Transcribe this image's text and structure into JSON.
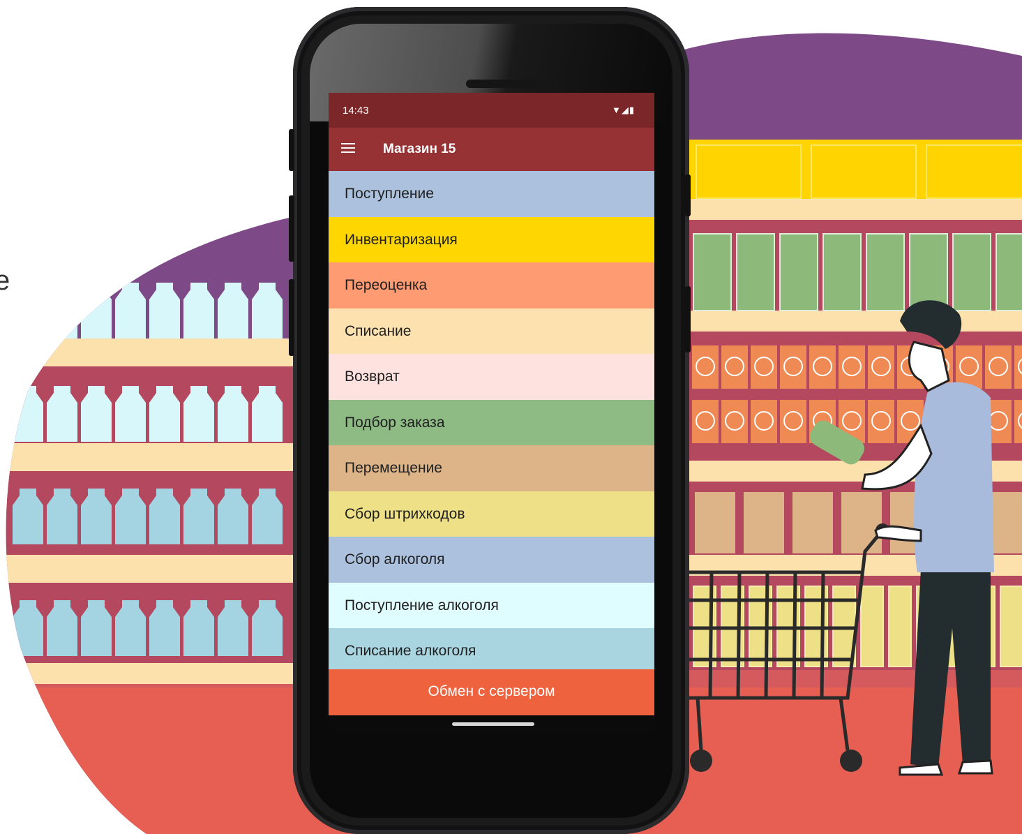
{
  "background": {
    "letter": "e",
    "colors": {
      "purple": "#7d4a87",
      "cream": "#fde1ad",
      "maroon": "#b3485f",
      "floor": "#e65f52",
      "yellow_box": "#ffd400",
      "green_box": "#8dba7a",
      "orange_can": "#f08a54",
      "bottle_light": "#d8f7fa",
      "bottle_blue": "#a4d3e1"
    }
  },
  "status": {
    "time": "14:43",
    "icons": "▼◢▮"
  },
  "app": {
    "store_name": "Магазин 15",
    "menu_icon": "hamburger-menu-icon"
  },
  "menu": [
    {
      "label": "Поступление",
      "color": "#abc1dd"
    },
    {
      "label": "Инвентаризация",
      "color": "#fed602"
    },
    {
      "label": "Переоценка",
      "color": "#fe9b73"
    },
    {
      "label": "Списание",
      "color": "#fde2b0"
    },
    {
      "label": "Возврат",
      "color": "#fde2e0"
    },
    {
      "label": "Подбор заказа",
      "color": "#8ebb84"
    },
    {
      "label": "Перемещение",
      "color": "#dcb487"
    },
    {
      "label": "Сбор штрихкодов",
      "color": "#ede087"
    },
    {
      "label": "Сбор алкоголя",
      "color": "#abc1dd"
    },
    {
      "label": "Поступление алкоголя",
      "color": "#dffcfe"
    },
    {
      "label": "Списание алкоголя",
      "color": "#a9d5e1"
    }
  ],
  "footer": {
    "exchange_label": "Обмен с сервером",
    "color": "#ef623e"
  }
}
